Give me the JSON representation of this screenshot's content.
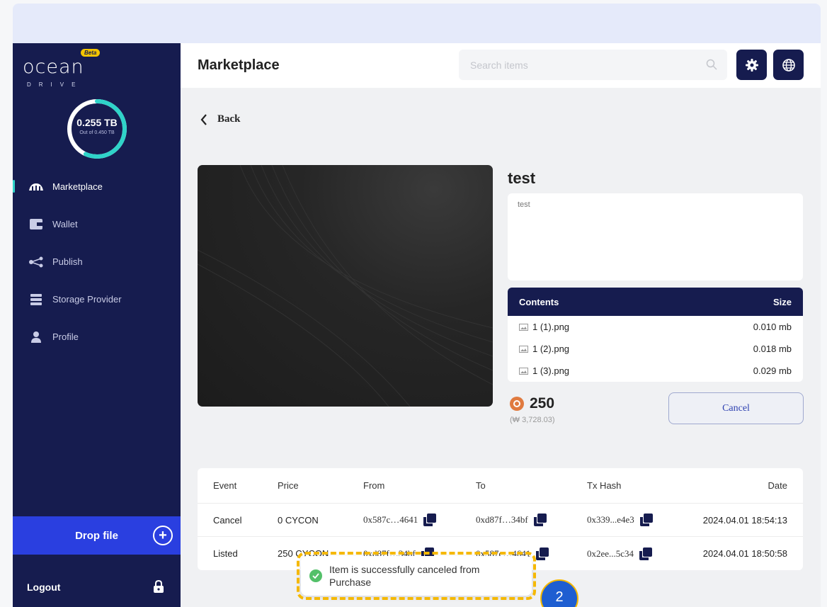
{
  "sidebar": {
    "logo_text": "ocean",
    "logo_subtext": "DRIVE",
    "beta_label": "Beta",
    "storage": {
      "used": "0.255 TB",
      "total": "Out of 0.450 TB",
      "used_fraction": 0.567
    },
    "nav": [
      {
        "label": "Marketplace",
        "icon": "marketplace-icon",
        "active": true
      },
      {
        "label": "Wallet",
        "icon": "wallet-icon",
        "active": false
      },
      {
        "label": "Publish",
        "icon": "share-icon",
        "active": false
      },
      {
        "label": "Storage Provider",
        "icon": "server-icon",
        "active": false
      },
      {
        "label": "Profile",
        "icon": "user-icon",
        "active": false
      }
    ],
    "drop_file_label": "Drop file",
    "logout_label": "Logout"
  },
  "header": {
    "title": "Marketplace",
    "search_placeholder": "Search items"
  },
  "detail": {
    "back_label": "Back",
    "title": "test",
    "description": "test",
    "contents_header": "Contents",
    "size_header": "Size",
    "files": [
      {
        "name": "1 (1).png",
        "size": "0.010 mb"
      },
      {
        "name": "1 (2).png",
        "size": "0.018 mb"
      },
      {
        "name": "1 (3).png",
        "size": "0.029 mb"
      }
    ],
    "price": "250",
    "price_converted": "(₩ 3,728.03)",
    "cancel_label": "Cancel"
  },
  "events": {
    "headers": [
      "Event",
      "Price",
      "From",
      "To",
      "Tx Hash",
      "Date"
    ],
    "rows": [
      {
        "event": "Cancel",
        "price": "0 CYCON",
        "from": "0x587c…4641",
        "to": "0xd87f…34bf",
        "tx": "0x339...e4e3",
        "date": "2024.04.01 18:54:13"
      },
      {
        "event": "Listed",
        "price": "250 CYCON",
        "from": "0xd87f…34bf",
        "to": "0x587c…4641",
        "tx": "0x2ee...5c34",
        "date": "2024.04.01 18:50:58"
      }
    ]
  },
  "toast": {
    "message": "Item is successfully canceled from Purchase"
  },
  "step_badge": "2",
  "colors": {
    "sidebar": "#161c4f",
    "accent": "#2a3fe0",
    "ring": "#2fd3c9",
    "highlight": "#f5b800"
  }
}
